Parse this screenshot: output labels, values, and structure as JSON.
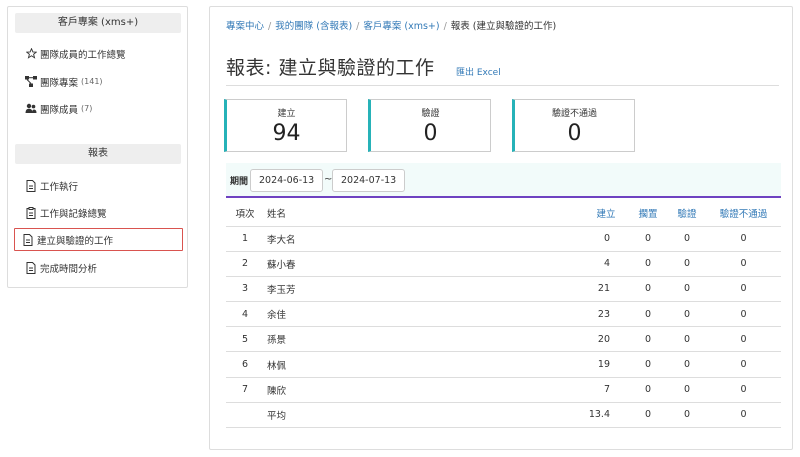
{
  "sidebar": {
    "section1_title": "客戶專案 (xms+)",
    "items1": [
      {
        "label": "團隊成員的工作總覽",
        "count": ""
      },
      {
        "label": "團隊專案",
        "count": "(141)"
      },
      {
        "label": "團隊成員",
        "count": "(7)"
      }
    ],
    "section2_title": "報表",
    "items2": [
      {
        "label": "工作執行"
      },
      {
        "label": "工作與記錄總覽"
      },
      {
        "label": "建立與驗證的工作"
      },
      {
        "label": "完成時間分析"
      }
    ]
  },
  "breadcrumb": {
    "items": [
      "專案中心",
      "我的團隊 (含報表)",
      "客戶專案 (xms+)"
    ],
    "current": "報表 (建立與驗證的工作)"
  },
  "page": {
    "title": "報表: 建立與驗證的工作",
    "export_label": "匯出 Excel"
  },
  "stats": [
    {
      "label": "建立",
      "value": "94"
    },
    {
      "label": "驗證",
      "value": "0"
    },
    {
      "label": "驗證不通過",
      "value": "0"
    }
  ],
  "filter": {
    "label": "期間",
    "start_date": "2024-06-13",
    "separator": "~",
    "end_date": "2024-07-13"
  },
  "table": {
    "headers": [
      "項次",
      "姓名",
      "建立",
      "擱置",
      "驗證",
      "驗證不通過"
    ],
    "rows": [
      [
        "1",
        "李大名",
        "0",
        "0",
        "0",
        "0"
      ],
      [
        "2",
        "蘇小春",
        "4",
        "0",
        "0",
        "0"
      ],
      [
        "3",
        "李玉芳",
        "21",
        "0",
        "0",
        "0"
      ],
      [
        "4",
        "余佳",
        "23",
        "0",
        "0",
        "0"
      ],
      [
        "5",
        "孫景",
        "20",
        "0",
        "0",
        "0"
      ],
      [
        "6",
        "林佩",
        "19",
        "0",
        "0",
        "0"
      ],
      [
        "7",
        "陳欣",
        "7",
        "0",
        "0",
        "0"
      ],
      [
        "",
        "平均",
        "13.4",
        "0",
        "0",
        "0"
      ]
    ]
  },
  "colors": {
    "accent_teal": "#26b2b8",
    "link_blue": "#337ab7",
    "active_border": "#d9534f",
    "table_rule_purple": "#6f42c1"
  },
  "icons": {
    "items1": [
      "star-icon",
      "project-tree-icon",
      "users-icon"
    ],
    "items2": [
      "file-icon",
      "clipboard-icon",
      "file-icon",
      "file-icon"
    ]
  }
}
